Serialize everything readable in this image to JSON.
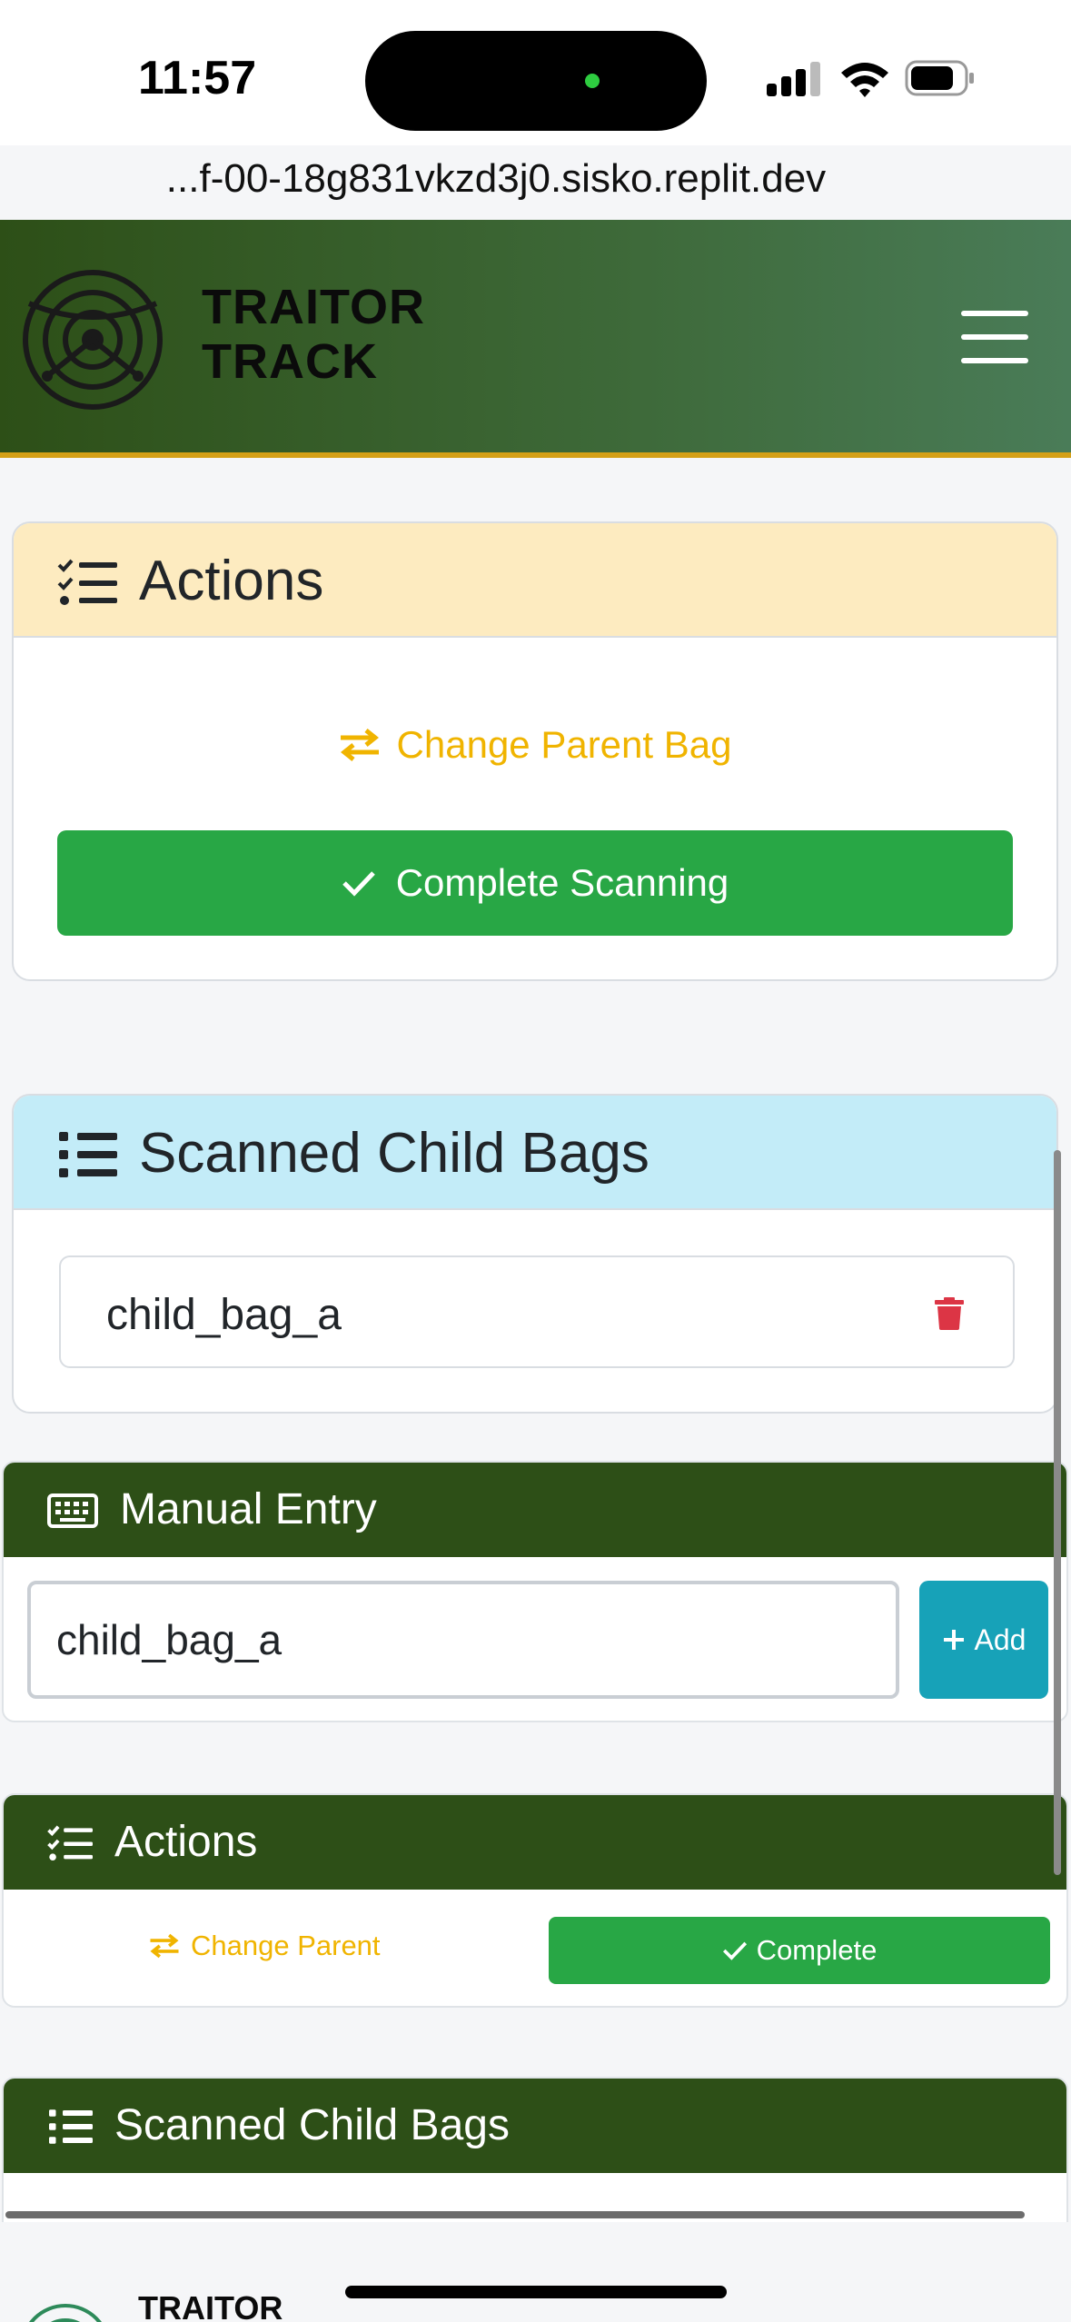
{
  "status_bar": {
    "time": "11:57"
  },
  "browser": {
    "url": "...f-00-18g831vkzd3j0.sisko.replit.dev"
  },
  "navbar": {
    "brand_line1": "TRAITOR",
    "brand_line2": "TRACK"
  },
  "actions_card": {
    "title": "Actions",
    "change_parent_label": "Change Parent Bag",
    "complete_label": "Complete Scanning"
  },
  "scanned_card": {
    "title": "Scanned Child Bags",
    "items": [
      {
        "name": "child_bag_a"
      }
    ]
  },
  "manual_entry": {
    "title": "Manual Entry",
    "input_value": "child_bag_a",
    "add_label": "Add"
  },
  "actions_compact": {
    "title": "Actions",
    "change_parent_label": "Change Parent",
    "complete_label": "Complete"
  },
  "scanned_compact": {
    "title": "Scanned Child Bags"
  },
  "footer": {
    "brand": "TRAITOR"
  },
  "colors": {
    "brand_green": "#2d4f17",
    "accent_gold": "#d4a017",
    "success": "#28a745",
    "info": "#17a2b8",
    "warning_text": "#f0b400",
    "danger": "#dc3545"
  }
}
